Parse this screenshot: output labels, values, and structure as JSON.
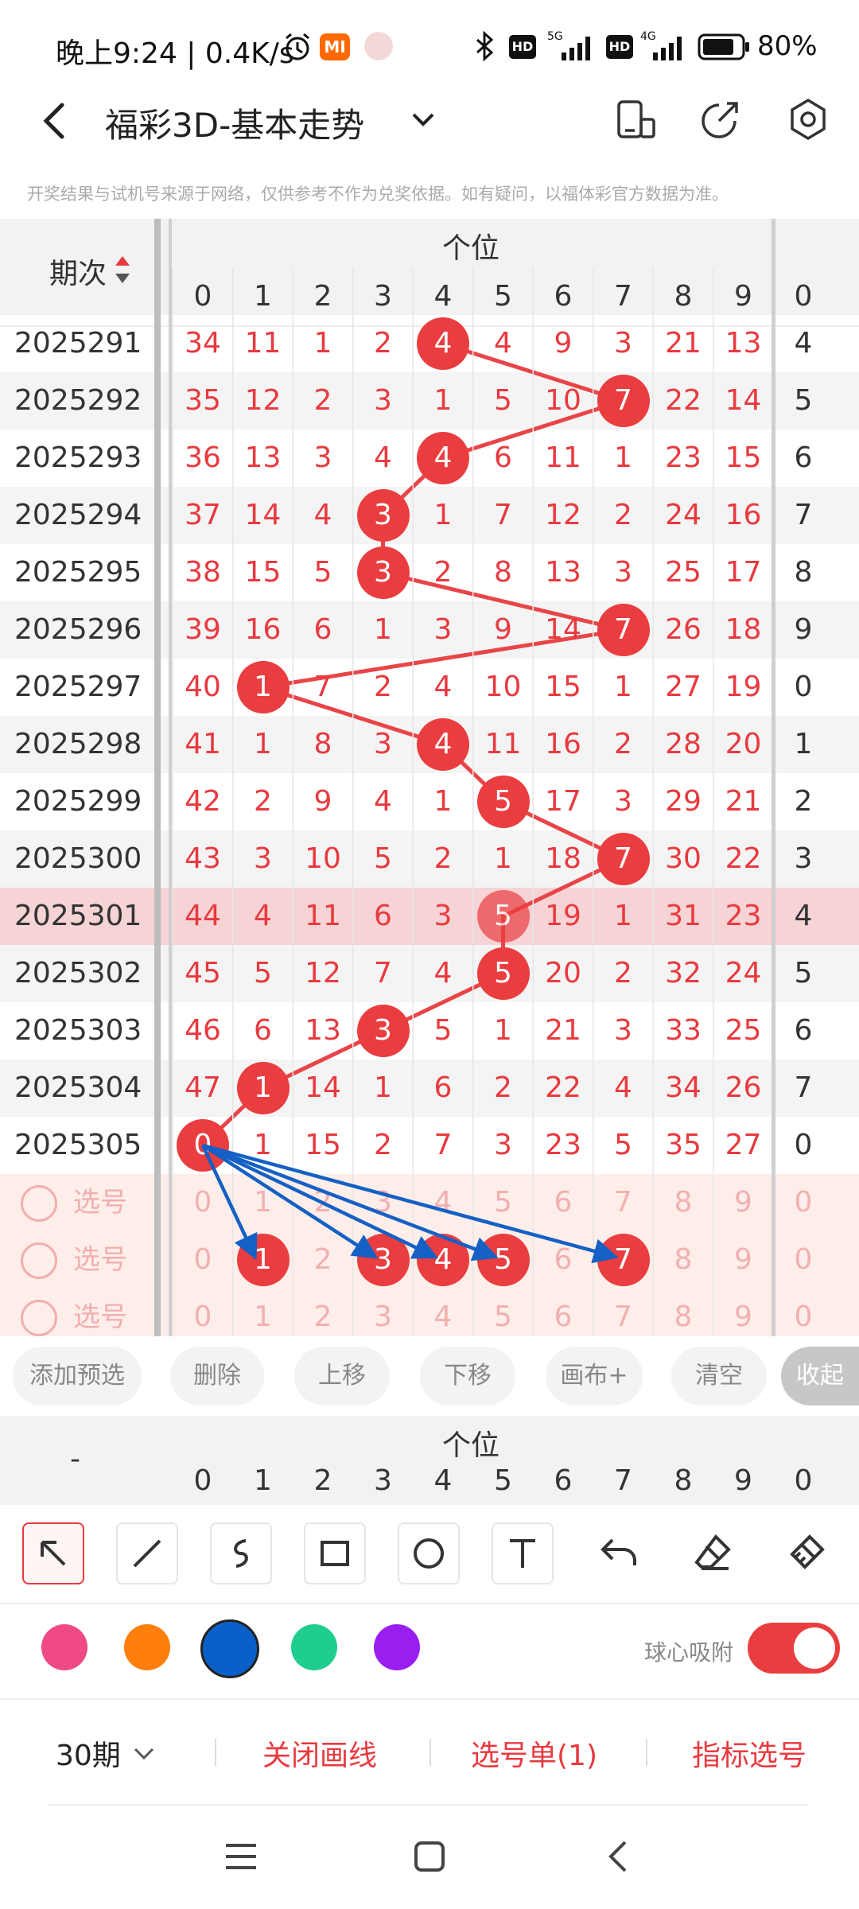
{
  "status_bar": {
    "time": "晚上9:24 | 0.4K/s",
    "app_icon": "MI",
    "battery": "80%",
    "icons": [
      "alarm-icon",
      "bluetooth-icon",
      "hd-icon",
      "5g-signal-icon",
      "4g-signal-icon",
      "battery-icon"
    ]
  },
  "nav": {
    "title": "福彩3D-基本走势",
    "icons": [
      "back-icon",
      "chevron-down-icon",
      "phone-icon",
      "share-icon",
      "settings-icon"
    ]
  },
  "notice": "开奖结果与试机号来源于网络，仅供参考不作为兑奖依据。如有疑问，以福体彩官方数据为准。",
  "table": {
    "period_header": "期次",
    "position_header": "个位",
    "digits": [
      "0",
      "1",
      "2",
      "3",
      "4",
      "5",
      "6",
      "7",
      "8",
      "9"
    ],
    "extra_digit": "0",
    "rows": [
      {
        "issue": "2025291",
        "cells": [
          "34",
          "11",
          "1",
          "2",
          "4",
          "4",
          "9",
          "3",
          "21",
          "13"
        ],
        "hit": 4,
        "extra": "4"
      },
      {
        "issue": "2025292",
        "cells": [
          "35",
          "12",
          "2",
          "3",
          "1",
          "5",
          "10",
          "7",
          "22",
          "14"
        ],
        "hit": 7,
        "extra": "5"
      },
      {
        "issue": "2025293",
        "cells": [
          "36",
          "13",
          "3",
          "4",
          "4",
          "6",
          "11",
          "1",
          "23",
          "15"
        ],
        "hit": 4,
        "extra": "6"
      },
      {
        "issue": "2025294",
        "cells": [
          "37",
          "14",
          "4",
          "3",
          "1",
          "7",
          "12",
          "2",
          "24",
          "16"
        ],
        "hit": 3,
        "extra": "7"
      },
      {
        "issue": "2025295",
        "cells": [
          "38",
          "15",
          "5",
          "3",
          "2",
          "8",
          "13",
          "3",
          "25",
          "17"
        ],
        "hit": 3,
        "extra": "8"
      },
      {
        "issue": "2025296",
        "cells": [
          "39",
          "16",
          "6",
          "1",
          "3",
          "9",
          "14",
          "7",
          "26",
          "18"
        ],
        "hit": 7,
        "extra": "9"
      },
      {
        "issue": "2025297",
        "cells": [
          "40",
          "1",
          "7",
          "2",
          "4",
          "10",
          "15",
          "1",
          "27",
          "19"
        ],
        "hit": 1,
        "extra": "0"
      },
      {
        "issue": "2025298",
        "cells": [
          "41",
          "1",
          "8",
          "3",
          "4",
          "11",
          "16",
          "2",
          "28",
          "20"
        ],
        "hit": 4,
        "extra": "1"
      },
      {
        "issue": "2025299",
        "cells": [
          "42",
          "2",
          "9",
          "4",
          "1",
          "5",
          "17",
          "3",
          "29",
          "21"
        ],
        "hit": 5,
        "extra": "2"
      },
      {
        "issue": "2025300",
        "cells": [
          "43",
          "3",
          "10",
          "5",
          "2",
          "1",
          "18",
          "7",
          "30",
          "22"
        ],
        "hit": 7,
        "extra": "3"
      },
      {
        "issue": "2025301",
        "cells": [
          "44",
          "4",
          "11",
          "6",
          "3",
          "5",
          "19",
          "1",
          "31",
          "23"
        ],
        "hit": 5,
        "extra": "4"
      },
      {
        "issue": "2025302",
        "cells": [
          "45",
          "5",
          "12",
          "7",
          "4",
          "5",
          "20",
          "2",
          "32",
          "24"
        ],
        "hit": 5,
        "extra": "5"
      },
      {
        "issue": "2025303",
        "cells": [
          "46",
          "6",
          "13",
          "3",
          "5",
          "1",
          "21",
          "3",
          "33",
          "25"
        ],
        "hit": 3,
        "extra": "6"
      },
      {
        "issue": "2025304",
        "cells": [
          "47",
          "1",
          "14",
          "1",
          "6",
          "2",
          "22",
          "4",
          "34",
          "26"
        ],
        "hit": 1,
        "extra": "7"
      },
      {
        "issue": "2025305",
        "cells": [
          "0",
          "1",
          "15",
          "2",
          "7",
          "3",
          "23",
          "5",
          "35",
          "27"
        ],
        "hit": 0,
        "extra": "0"
      }
    ],
    "pick_label": "选号",
    "pick_rows": [
      {
        "selected": []
      },
      {
        "selected": [
          1,
          3,
          4,
          5,
          7
        ]
      },
      {
        "selected": []
      }
    ]
  },
  "actions": [
    "添加预选",
    "删除",
    "上移",
    "下移",
    "画布+",
    "清空",
    "收起"
  ],
  "second_header": {
    "period": "-",
    "position": "个位"
  },
  "draw_tools": [
    "arrow-tool-icon",
    "line-tool-icon",
    "curve-tool-icon",
    "rectangle-tool-icon",
    "circle-tool-icon",
    "text-tool-icon",
    "undo-icon",
    "eraser-icon",
    "clear-brush-icon"
  ],
  "colors": [
    "#f04a86",
    "#ff7f0e",
    "#0b5fc8",
    "#1fce8f",
    "#9b1ef0"
  ],
  "snap_label": "球心吸附",
  "snap_on": true,
  "bottom": {
    "period": "30期",
    "close_draw": "关闭画线",
    "pick_list": "选号单(1)",
    "indicator": "指标选号"
  }
}
